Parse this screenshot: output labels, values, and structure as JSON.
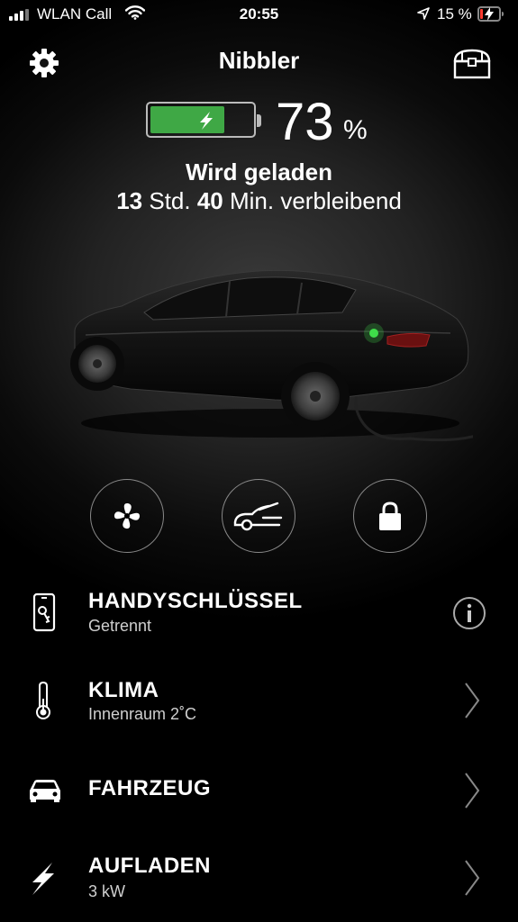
{
  "status_bar": {
    "carrier": "WLAN Call",
    "time": "20:55",
    "battery_percent": "15 %",
    "battery_level": 0.15,
    "battery_color": "#ff3b30"
  },
  "header": {
    "car_name": "Nibbler",
    "left_icon": "gear-icon",
    "right_icon": "trunk-icon"
  },
  "battery": {
    "level_percent": 73,
    "value": "73",
    "unit": "%",
    "fill_color": "#3fa845"
  },
  "charging": {
    "status": "Wird geladen",
    "hours": "13",
    "hours_unit": "Std.",
    "minutes": "40",
    "minutes_unit": "Min. verbleibend"
  },
  "actions": [
    {
      "icon": "fan-icon"
    },
    {
      "icon": "frunk-icon"
    },
    {
      "icon": "lock-icon"
    }
  ],
  "list": [
    {
      "icon": "phone-key-icon",
      "label": "HANDYSCHLÜSSEL",
      "sub": "Getrennt",
      "trailing": "info-icon"
    },
    {
      "icon": "thermometer-icon",
      "label": "KLIMA",
      "sub": "Innenraum 2˚C",
      "trailing": "chevron-right-icon"
    },
    {
      "icon": "car-icon",
      "label": "FAHRZEUG",
      "sub": "",
      "trailing": "chevron-right-icon"
    },
    {
      "icon": "bolt-icon",
      "label": "AUFLADEN",
      "sub": "3 kW",
      "trailing": "chevron-right-icon"
    }
  ]
}
